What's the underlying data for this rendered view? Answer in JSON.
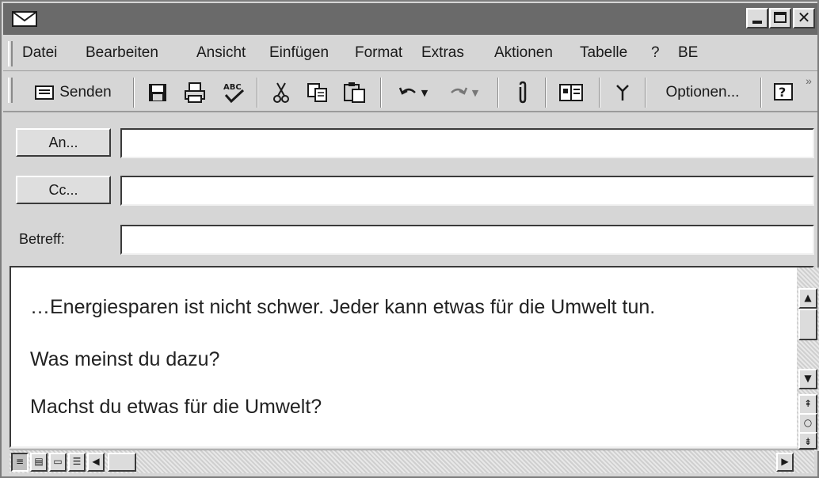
{
  "menubar": {
    "items": [
      "Datei",
      "Bearbeiten",
      "Ansicht",
      "Einfügen",
      "Format",
      "Extras",
      "Aktionen",
      "Tabelle",
      "?",
      "BE"
    ]
  },
  "toolbar": {
    "send_label": "Senden",
    "options_label": "Optionen...",
    "overflow": "»"
  },
  "fields": {
    "to_label": "An...",
    "cc_label": "Cc...",
    "subject_label": "Betreff:",
    "to_value": "",
    "cc_value": "",
    "subject_value": ""
  },
  "message": {
    "line1": "…Energiesparen ist nicht schwer. Jeder kann etwas für die Umwelt tun.",
    "line2": "Was meinst du dazu?",
    "line3": "Machst du etwas für die Umwelt?"
  },
  "colors": {
    "titlebar": "#6a6a6a",
    "chrome": "#d6d6d6"
  }
}
